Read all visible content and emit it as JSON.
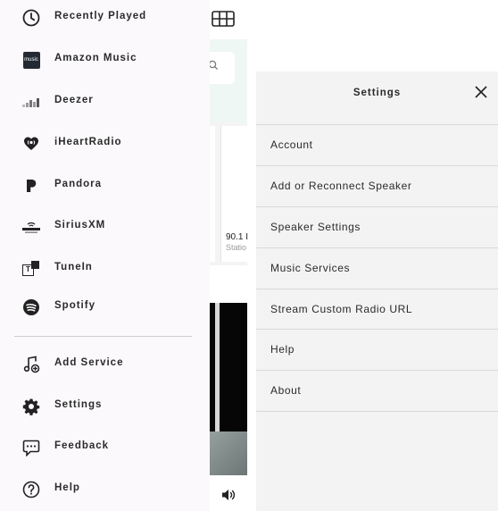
{
  "drawer": {
    "services": [
      {
        "label": "Recently Played",
        "icon": "clock-icon"
      },
      {
        "label": "Amazon Music",
        "icon": "amazon-music-icon"
      },
      {
        "label": "Deezer",
        "icon": "deezer-icon"
      },
      {
        "label": "iHeartRadio",
        "icon": "iheartradio-icon"
      },
      {
        "label": "Pandora",
        "icon": "pandora-icon"
      },
      {
        "label": "SiriusXM",
        "icon": "siriusxm-icon"
      },
      {
        "label": "TuneIn",
        "icon": "tunein-icon"
      },
      {
        "label": "Spotify",
        "icon": "spotify-icon"
      }
    ],
    "actions": [
      {
        "label": "Add Service",
        "icon": "add-music-icon"
      },
      {
        "label": "Settings",
        "icon": "gear-icon"
      },
      {
        "label": "Feedback",
        "icon": "feedback-icon"
      },
      {
        "label": "Help",
        "icon": "help-icon"
      }
    ],
    "amazon_icon_text": "music",
    "tunein_icon_text": "T"
  },
  "background": {
    "station_frequency": "90.1 I",
    "station_subtitle": "Statio"
  },
  "settings": {
    "title": "Settings",
    "items": [
      {
        "label": "Account"
      },
      {
        "label": "Add or Reconnect Speaker"
      },
      {
        "label": "Speaker Settings"
      },
      {
        "label": "Music Services"
      },
      {
        "label": "Stream Custom Radio URL"
      },
      {
        "label": "Help"
      },
      {
        "label": "About"
      }
    ]
  },
  "colors": {
    "drawer_bg": "#fbf9fc",
    "panel_bg": "#f3f3f3",
    "search_area": "#eef7f4",
    "text": "#2a2a2a"
  }
}
